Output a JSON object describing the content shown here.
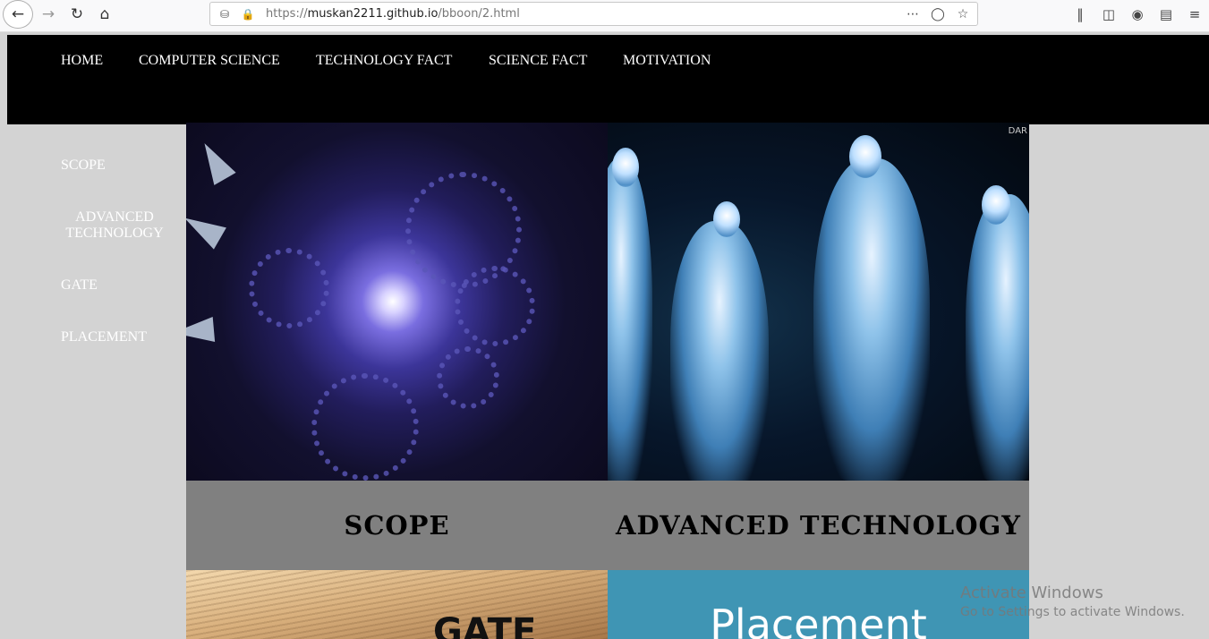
{
  "browser": {
    "url_prefix": "https://",
    "url_host": "muskan2211.github.io",
    "url_path": "/bboon/2.html",
    "icons": [
      "back-icon",
      "forward-icon",
      "reload-icon",
      "home-icon",
      "shield-icon",
      "lock-icon",
      "more-icon",
      "pocket-icon",
      "bookmark-star-icon",
      "library-icon",
      "sidebar-icon",
      "account-icon",
      "extension-icon",
      "menu-icon"
    ]
  },
  "topnav": {
    "items": [
      "HOME",
      "COMPUTER SCIENCE",
      "TECHNOLOGY FACT",
      "SCIENCE FACT",
      "MOTIVATION"
    ]
  },
  "sidenav": {
    "items": [
      "SCOPE",
      "ADVANCED TECHNOLOGY",
      "GATE",
      "PLACEMENT"
    ]
  },
  "tiles": {
    "scope_caption": "SCOPE",
    "advanced_caption": "ADVANCED TECHNOLOGY",
    "alien_watermark": "DAR",
    "gate_image_text": "GATE",
    "placement_image_text": "Placement"
  },
  "watermark": {
    "title": "Activate Windows",
    "subtitle": "Go to Settings to activate Windows."
  },
  "colors": {
    "nav_bg": "#000000",
    "page_bg": "#d3d3d3",
    "caption_bg": "#808080",
    "placement_bg": "#3f95b4"
  }
}
